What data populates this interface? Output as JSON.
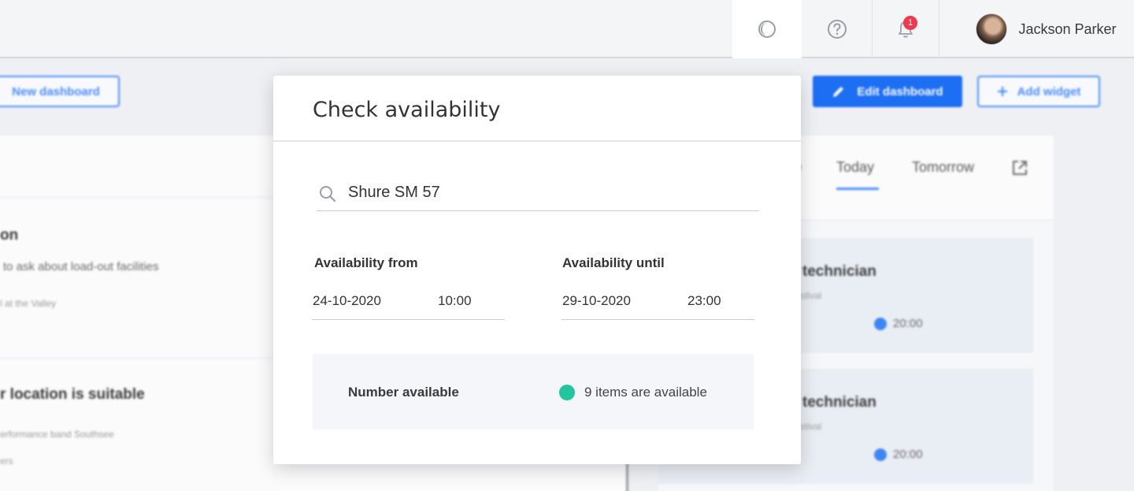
{
  "topbar": {
    "notification_count": "1",
    "user_name": "Jackson Parker",
    "icons": {
      "theme": "theme-toggle-icon",
      "help": "help-icon",
      "bell": "bell-icon"
    }
  },
  "background": {
    "buttons": {
      "new_dashboard": "New dashboard",
      "edit_dashboard": "Edit dashboard",
      "add_widget": "Add widget"
    },
    "left_items": [
      {
        "title": "on",
        "subtitle": "to ask about load-out facilities",
        "meta": "l at the Valley"
      },
      {
        "title": "r location is suitable",
        "subtitle": "",
        "meta": "erformance band Southsee",
        "meta2": "ers"
      }
    ],
    "tabs": {
      "partial": "e",
      "today": "Today",
      "tomorrow": "Tomorrow"
    },
    "events": [
      {
        "title": "d technician",
        "sub": "stival",
        "time": "20:00"
      },
      {
        "title": "d technician",
        "sub": "stival",
        "time": "20:00"
      }
    ]
  },
  "modal": {
    "title": "Check availability",
    "search_value": "Shure SM 57",
    "from_label": "Availability from",
    "from_date": "24-10-2020",
    "from_time": "10:00",
    "until_label": "Availability until",
    "until_date": "29-10-2020",
    "until_time": "23:00",
    "number_label": "Number available",
    "number_status": "9 items are available"
  },
  "colors": {
    "accent": "#1c6ef2",
    "outline_blue": "#4b8df7",
    "available_green": "#21c6a0",
    "badge_red": "#f2384f"
  }
}
